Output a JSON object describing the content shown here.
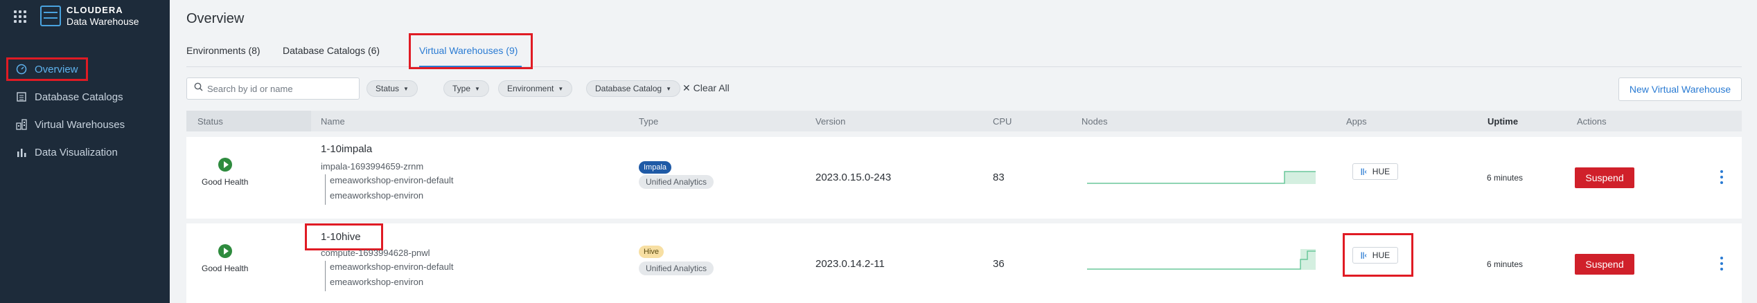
{
  "brand": {
    "name": "CLOUDERA",
    "product": "Data Warehouse"
  },
  "sidebar": {
    "items": [
      {
        "label": "Overview",
        "icon": "gauge-icon",
        "active": true
      },
      {
        "label": "Database Catalogs",
        "icon": "catalog-icon"
      },
      {
        "label": "Virtual Warehouses",
        "icon": "warehouse-icon"
      },
      {
        "label": "Data Visualization",
        "icon": "bar-chart-icon"
      }
    ]
  },
  "page": {
    "title": "Overview"
  },
  "tabs": [
    {
      "label": "Environments (8)"
    },
    {
      "label": "Database Catalogs (6)"
    },
    {
      "label": "Virtual Warehouses (9)",
      "active": true
    }
  ],
  "toolbar": {
    "search_placeholder": "Search by id or name",
    "filters": [
      "Status",
      "Type",
      "Environment",
      "Database Catalog"
    ],
    "clear_all": "Clear All",
    "new_button": "New Virtual Warehouse"
  },
  "table": {
    "headers": {
      "status": "Status",
      "name": "Name",
      "type": "Type",
      "version": "Version",
      "cpu": "CPU",
      "nodes": "Nodes",
      "apps": "Apps",
      "uptime": "Uptime",
      "actions": "Actions"
    },
    "rows": [
      {
        "status": "Good Health",
        "name": "1-10impala",
        "id": "impala-1693994659-zrnm",
        "env1": "emeaworkshop-environ-default",
        "env2": "emeaworkshop-environ",
        "type_badge": "Impala",
        "type_sub": "Unified Analytics",
        "version": "2023.0.15.0-243",
        "cpu": "83",
        "app": "HUE",
        "uptime": "6 minutes",
        "action": "Suspend"
      },
      {
        "status": "Good Health",
        "name": "1-10hive",
        "id": "compute-1693994628-pnwl",
        "env1": "emeaworkshop-environ-default",
        "env2": "emeaworkshop-environ",
        "type_badge": "Hive",
        "type_sub": "Unified Analytics",
        "version": "2023.0.14.2-11",
        "cpu": "36",
        "app": "HUE",
        "uptime": "6 minutes",
        "action": "Suspend"
      }
    ]
  },
  "colors": {
    "accent": "#2a7bd3",
    "sidebar": "#1d2b3a",
    "suspend": "#d0202a",
    "health": "#2e8b3e",
    "highlight": "#e01b24"
  }
}
